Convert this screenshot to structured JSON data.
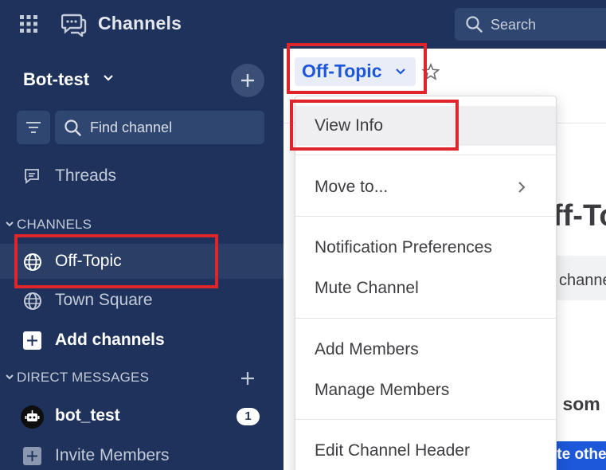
{
  "app": {
    "product_name": "Channels"
  },
  "search": {
    "placeholder": "Search"
  },
  "sidebar": {
    "team_name": "Bot-test",
    "find_channel": "Find channel",
    "threads": "Threads",
    "channels_section": "CHANNELS",
    "channels": [
      {
        "name": "Off-Topic",
        "active": true
      },
      {
        "name": "Town Square",
        "active": false
      }
    ],
    "add_channels": "Add channels",
    "dm_section": "DIRECT MESSAGES",
    "direct_messages": [
      {
        "name": "bot_test",
        "mentions": "1"
      }
    ],
    "invite_members": "Invite Members"
  },
  "channel": {
    "title": "Off-Topic"
  },
  "main_partial": {
    "intro_title": "ff-To",
    "chip_text": "channe",
    "intro_line": "d som",
    "cta_text": "ite othe"
  },
  "menu": {
    "items": [
      {
        "label": "View Info",
        "selected": true
      },
      {
        "label": "Move to...",
        "submenu": true
      },
      {
        "label": "Notification Preferences"
      },
      {
        "label": "Mute Channel"
      },
      {
        "label": "Add Members"
      },
      {
        "label": "Manage Members"
      },
      {
        "label": "Edit Channel Header"
      }
    ]
  },
  "colors": {
    "sidebar_bg": "#1e325c",
    "active_item_bg": "#2b3f66",
    "accent": "#1c58d9",
    "highlight": "#e0242b"
  },
  "icons": {
    "apps": "grid-icon",
    "product": "channels-icon",
    "search": "search-icon",
    "filter": "filter-icon",
    "threads": "threads-icon",
    "public_channel": "globe-icon",
    "favorite": "star-icon"
  }
}
